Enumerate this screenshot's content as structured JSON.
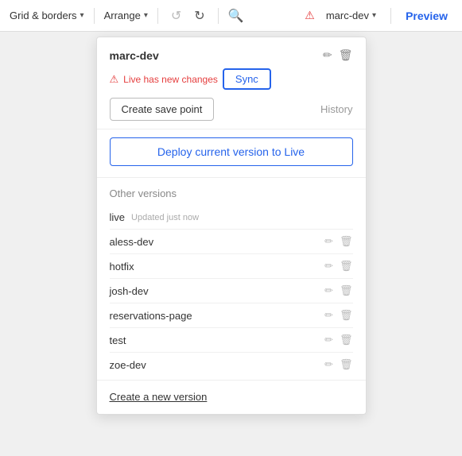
{
  "toolbar": {
    "grid_borders_label": "Grid & borders",
    "arrange_label": "Arrange",
    "undo_icon": "↺",
    "redo_icon": "↻",
    "search_icon": "🔍",
    "alert_icon": "⚠",
    "branch_name": "marc-dev",
    "preview_label": "Preview"
  },
  "panel": {
    "branch_name": "marc-dev",
    "edit_icon": "✏",
    "delete_icon": "🗑",
    "warning_icon": "⚠",
    "warning_text": "Live has new changes",
    "sync_label": "Sync",
    "save_point_label": "Create save point",
    "history_label": "History",
    "deploy_label": "Deploy current version to Live",
    "other_versions_title": "Other versions",
    "versions": [
      {
        "name": "live",
        "tag": "Updated just now",
        "has_tag": true
      },
      {
        "name": "aless-dev",
        "tag": "",
        "has_tag": false
      },
      {
        "name": "hotfix",
        "tag": "",
        "has_tag": false
      },
      {
        "name": "josh-dev",
        "tag": "",
        "has_tag": false
      },
      {
        "name": "reservations-page",
        "tag": "",
        "has_tag": false
      },
      {
        "name": "test",
        "tag": "",
        "has_tag": false
      },
      {
        "name": "zoe-dev",
        "tag": "",
        "has_tag": false
      }
    ],
    "create_new_label": "Create a new version"
  }
}
